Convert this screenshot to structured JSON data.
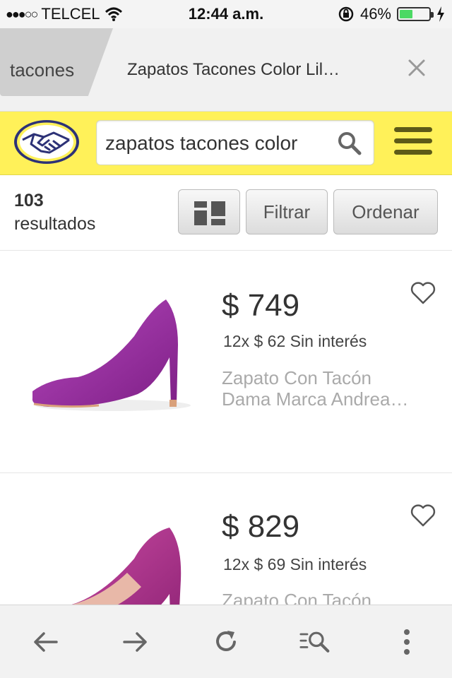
{
  "status_bar": {
    "carrier": "TELCEL",
    "signal": "●●●○○",
    "time": "12:44 a.m.",
    "battery": "46%",
    "battery_level": 0.46
  },
  "tabs": [
    {
      "label": "tacones"
    },
    {
      "label": "Zapatos Tacones Color Lil…"
    }
  ],
  "header": {
    "search_value": "zapatos tacones color"
  },
  "results": {
    "count": "103",
    "label": "resultados",
    "filter_label": "Filtrar",
    "sort_label": "Ordenar"
  },
  "items": [
    {
      "price": "$ 749",
      "installments": "12x $ 62 Sin interés",
      "title_line1": "Zapato Con Tacón",
      "title_line2": "Dama Marca Andrea…",
      "shoe_color": "#9b2fa3"
    },
    {
      "price": "$ 829",
      "installments": "12x $ 69 Sin interés",
      "title_line1": "Zapato Con Tacón",
      "title_line2": "",
      "shoe_color": "#b03a93"
    }
  ],
  "colors": {
    "header_yellow": "#fff159",
    "battery_green": "#4cd964"
  },
  "icons": {
    "back": "arrow-left-icon",
    "forward": "arrow-right-icon",
    "reload": "reload-icon",
    "find": "find-in-page-icon",
    "more": "more-vertical-icon"
  }
}
